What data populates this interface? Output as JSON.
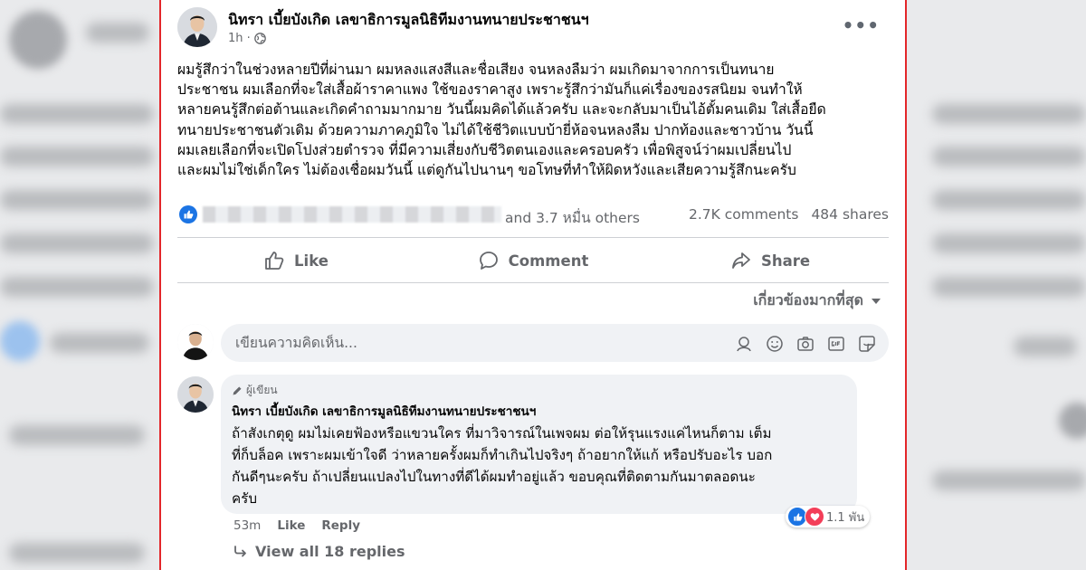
{
  "post": {
    "author": "นิทรา เบี้ยบังเกิด เลขาธิการมูลนิธิทีมงานทนายประชาชนฯ",
    "time": "1h ·",
    "more": "•••",
    "body_lines": [
      "ผมรู้สึกว่าในช่วงหลายปีที่ผ่านมา ผมหลงแสงสีและชื่อเสียง จนหลงลืมว่า ผมเกิดมาจากการเป็นทนาย",
      "ประชาชน ผมเลือกที่จะใส่เสื้อผ้าราคาแพง ใช้ของราคาสูง เพราะรู้สึกว่ามันก็แค่เรื่องของรสนิยม จนทำให้",
      "หลายคนรู้สึกต่อต้านและเกิดคำถามมากมาย วันนี้ผมคิดได้แล้วครับ และจะกลับมาเป็นไอ้ตั้มคนเดิม ใส่เสื้อยืด",
      "ทนายประชาชนตัวเดิม ด้วยความภาคภูมิใจ ไม่ได้ใช้ชีวิตแบบบ้ายี่ห้อจนหลงลืม ปากท้องและชาวบ้าน วันนี้",
      "ผมเลยเลือกที่จะเปิดโปงส่วยตำรวจ ที่มีความเสี่ยงกับชีวิตตนเองและครอบครัว เพื่อพิสูจน์ว่าผมเปลี่ยนไป",
      "และผมไม่ใช่เด็กใคร ไม่ต้องเชื่อผมวันนี้ แต่ดูกันไปนานๆ ขอโทษที่ทำให้ผิดหวังและเสียความรู้สึกนะครับ"
    ],
    "reactions_others": "and 3.7 หมื่น others",
    "comments_count": "2.7K comments",
    "shares_count": "484 shares"
  },
  "actions": {
    "like": "Like",
    "comment": "Comment",
    "share": "Share"
  },
  "sort_label": "เกี่ยวข้องมากที่สุด",
  "composer": {
    "placeholder": "เขียนความคิดเห็น..."
  },
  "comment": {
    "author_badge": "ผู้เขียน",
    "author": "นิทรา เบี้ยบังเกิด เลขาธิการมูลนิธิทีมงานทนายประชาชนฯ",
    "lines": [
      "ถ้าสังเกตุดู ผมไม่เคยฟ้องหรือแขวนใคร ที่มาวิจารณ์ในเพจผม ต่อให้รุนแรงแค่ไหนก็ตาม เต็ม",
      "ที่ก็บล็อค เพราะผมเข้าใจดี ว่าหลายครั้งผมก็ทำเกินไปจริงๆ ถ้าอยากให้แก้ หรือปรับอะไร บอก",
      "กันดีๆนะครับ ถ้าเปลี่ยนแปลงไปในทางที่ดีได้ผมทำอยู่แล้ว ขอบคุณที่ติดตามกันมาตลอดนะ",
      "ครับ"
    ],
    "reaction_count": "1.1 พัน",
    "time": "53m",
    "like": "Like",
    "reply": "Reply",
    "view_replies": "View all 18 replies"
  },
  "colors": {
    "accent_blue": "#1b74e4",
    "love_red": "#f33e58",
    "frame_red": "#e3262a",
    "muted_text": "#65676b"
  }
}
